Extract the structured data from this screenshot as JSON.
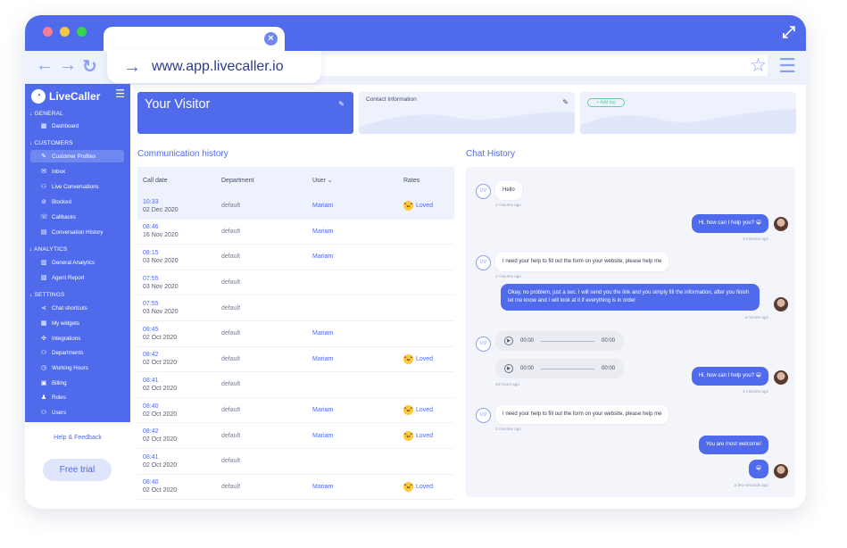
{
  "browser": {
    "url": "www.app.livecaller.io",
    "colors": {
      "red": "#f47d98",
      "yellow": "#f7c743",
      "green": "#39d34f"
    }
  },
  "sidebar": {
    "brand": "LiveCaller",
    "sections": {
      "general": "GENERAL",
      "customers": "CUSTOMERS",
      "analytics": "ANALYTICS",
      "settings": "SETTINGS"
    },
    "items": {
      "dashboard": "Dashboard",
      "customer_profiles": "Customer Profiles",
      "inbox": "Inbox",
      "live_conversations": "Live Conversations",
      "blocked": "Blocked",
      "callbacks": "Callbacks",
      "conversation_history": "Conversation History",
      "general_analytics": "General Analytics",
      "agent_report": "Agent Report",
      "chat_shortcuts": "Chat shortcuts",
      "my_widgets": "My widgets",
      "integrations": "Integrations",
      "departments": "Departments",
      "working_hours": "Working Hours",
      "billing": "Billing",
      "roles": "Roles",
      "users": "Users"
    },
    "help": "Help & Feedback",
    "free_trial": "Free trial"
  },
  "cards": {
    "visitor_title": "Your Visitor",
    "contact_title": "Contact Information",
    "add_tag": "+ Add tag"
  },
  "comm": {
    "title": "Communication history",
    "headers": {
      "date": "Call date",
      "dept": "Department",
      "user": "User",
      "rates": "Rates"
    },
    "rows": [
      {
        "time": "10:33",
        "date": "02 Dec 2020",
        "dept": "default",
        "user": "Mariam",
        "rate": "Loved"
      },
      {
        "time": "08:46",
        "date": "16 Nov 2020",
        "dept": "default",
        "user": "Mariam",
        "rate": ""
      },
      {
        "time": "08:15",
        "date": "03 Nov 2020",
        "dept": "default",
        "user": "Mariam",
        "rate": ""
      },
      {
        "time": "07:55",
        "date": "03 Nov 2020",
        "dept": "default",
        "user": "",
        "rate": ""
      },
      {
        "time": "07:55",
        "date": "03 Nov 2020",
        "dept": "default",
        "user": "",
        "rate": ""
      },
      {
        "time": "08:45",
        "date": "02 Oct 2020",
        "dept": "default",
        "user": "Mariam",
        "rate": ""
      },
      {
        "time": "08:42",
        "date": "02 Oct 2020",
        "dept": "default",
        "user": "Mariam",
        "rate": "Loved"
      },
      {
        "time": "08:41",
        "date": "02 Oct 2020",
        "dept": "default",
        "user": "",
        "rate": ""
      },
      {
        "time": "08:40",
        "date": "02 Oct 2020",
        "dept": "default",
        "user": "Mariam",
        "rate": "Loved"
      },
      {
        "time": "08:42",
        "date": "02 Oct 2020",
        "dept": "default",
        "user": "Mariam",
        "rate": "Loved"
      },
      {
        "time": "08:41",
        "date": "02 Oct 2020",
        "dept": "default",
        "user": "",
        "rate": ""
      },
      {
        "time": "08:40",
        "date": "02 Oct 2020",
        "dept": "default",
        "user": "Mariam",
        "rate": "Loved"
      }
    ]
  },
  "chat": {
    "title": "Chat History",
    "uv": "UV",
    "msg1": "Hello",
    "meta1": "2 minutes ago",
    "msg2": "Hi, how can I help you? 😀",
    "meta2": "3 minutes ago",
    "msg3": "I need your help to fill out the form on your website, please help me",
    "meta3": "2 minutes ago",
    "msg4": "Okay, no problem, just a sec. I will send you the link and you simply fill the information, after you finish let me know and I will look at it if everything is in order",
    "meta4": "a minute ago",
    "audio_start": "00:00",
    "audio_end": "00:00",
    "msg5": "Hi, how can I help you? 😀",
    "meta5a": "10 hours ago",
    "meta5b": "3 minutes ago",
    "msg6": "I need your help to fill out the form on your website, please help me",
    "meta6": "2 minutes ago",
    "msg7": "You are most welcome!",
    "msg8": "😀",
    "meta8": "a few seconds ago"
  }
}
